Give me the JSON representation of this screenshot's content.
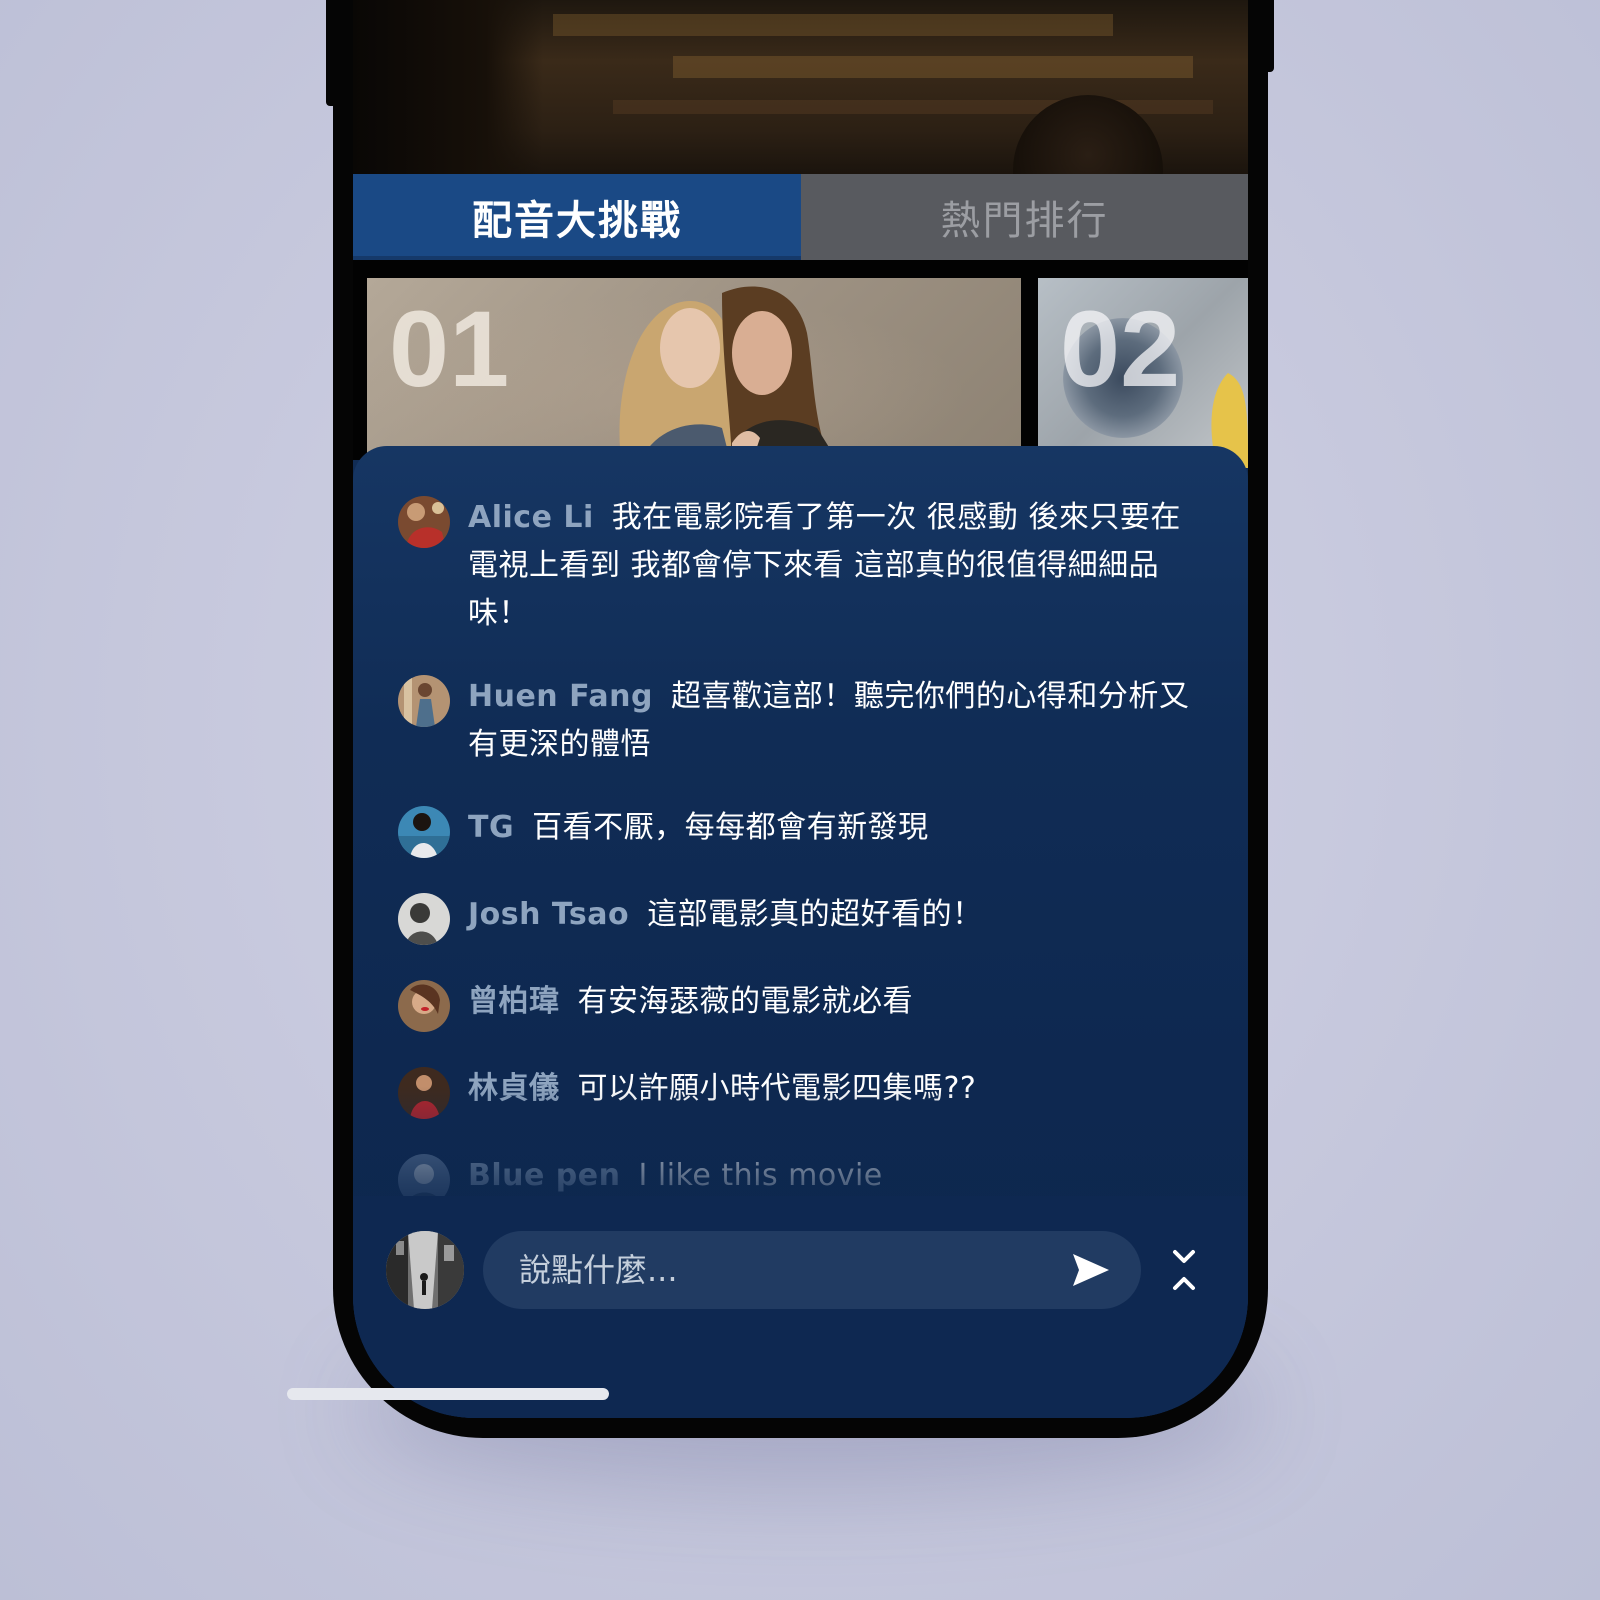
{
  "tabs": [
    {
      "label": "配音大挑戰",
      "active": true
    },
    {
      "label": "熱門排行",
      "active": false
    }
  ],
  "cards": [
    {
      "number": "01"
    },
    {
      "number": "02"
    }
  ],
  "messages": [
    {
      "name": "Alice Li",
      "text": "我在電影院看了第一次 很感動 後來只要在電視上看到 我都會停下來看 這部真的很值得細細品味！",
      "avatar_icon": "woman-red-dress-avatar"
    },
    {
      "name": "Huen Fang",
      "text": "超喜歡這部！聽完你們的心得和分析又有更深的體悟",
      "avatar_icon": "woman-standing-avatar"
    },
    {
      "name": "TG",
      "text": "百看不厭，每每都會有新發現",
      "avatar_icon": "woman-blue-avatar"
    },
    {
      "name": "Josh Tsao",
      "text": "這部電影真的超好看的！",
      "avatar_icon": "man-portrait-avatar"
    },
    {
      "name": "曾柏瑋",
      "text": "有安海瑟薇的電影就必看",
      "avatar_icon": "woman-red-lips-avatar"
    },
    {
      "name": "林貞儀",
      "text": "可以許願小時代電影四集嗎??",
      "avatar_icon": "woman-red-dress-avatar"
    },
    {
      "name": "Blue pen",
      "text": "I like this movie",
      "avatar_icon": "blue-figure-avatar"
    }
  ],
  "input": {
    "placeholder": "說點什麼..."
  },
  "icons": {
    "send": "send-icon",
    "collapse": "collapse-chevrons-icon"
  },
  "colors": {
    "active_tab": "#1a4985",
    "inactive_tab": "#585a5f",
    "panel": "#0e2850",
    "username": "#8ea4bf"
  }
}
